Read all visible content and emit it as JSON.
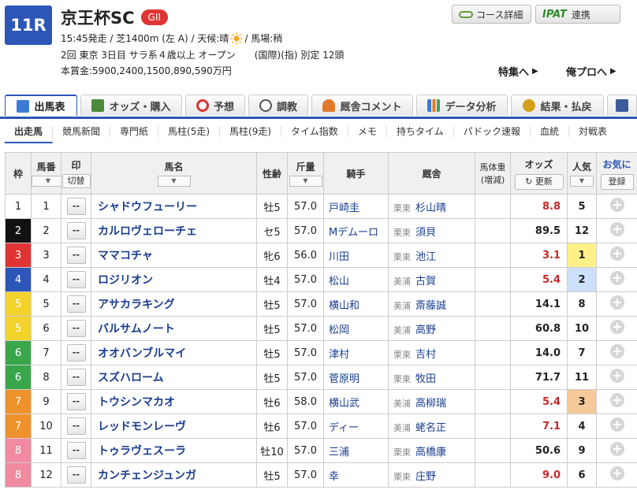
{
  "header": {
    "race_no": "11R",
    "race_name": "京王杯SC",
    "grade": "GII",
    "info_line1_a": "15:45発走 / 芝1400m (左 A) / 天候:晴",
    "info_line1_b": "/ 馬場:稍",
    "info_line2": "2回 東京 3日目 サラ系４歳以上 オープン　　(国際)(指) 別定 12頭",
    "info_line3": "本賞金:5900,2400,1500,890,590万円",
    "course_btn": "コース詳細",
    "ipat_logo": "IPAT",
    "ipat_btn": "連携",
    "link_feature": "特集へ",
    "link_pro": "俺プロへ"
  },
  "tabs": [
    {
      "label": "出馬表",
      "icon": "table-icon",
      "color": "#3a7bd5"
    },
    {
      "label": "オッズ・購入",
      "icon": "odds-icon",
      "color": "#4c8b3a"
    },
    {
      "label": "予想",
      "icon": "target-icon",
      "color": "#d33"
    },
    {
      "label": "調教",
      "icon": "stopwatch-icon",
      "color": "#555"
    },
    {
      "label": "厩舎コメント",
      "icon": "stable-icon",
      "color": "#e07a2a"
    },
    {
      "label": "データ分析",
      "icon": "chart-icon",
      "color": "#3a7bd5"
    },
    {
      "label": "結果・払戻",
      "icon": "coins-icon",
      "color": "#d4a017"
    },
    {
      "label": "",
      "icon": "video-icon",
      "color": "#3b5b9a"
    }
  ],
  "subnav": [
    "出走馬",
    "競馬新聞",
    "専門紙",
    "馬柱(5走)",
    "馬柱(9走)",
    "タイム指数",
    "メモ",
    "持ちタイム",
    "パドック速報",
    "血統",
    "対戦表"
  ],
  "table": {
    "headers": {
      "waku": "枠",
      "umaban": "馬番",
      "mark": "印",
      "mark_btn": "切替",
      "name": "馬名",
      "sexage": "性齢",
      "weight": "斤量",
      "jockey": "騎手",
      "stable": "厩舎",
      "body": "馬体重",
      "body_sub": "(増減)",
      "odds": "オッズ",
      "refresh": "更新",
      "pop": "人気",
      "fav": "お気に",
      "reg": "登録"
    },
    "mark_value": "--",
    "rows": [
      {
        "waku": "1",
        "umaban": "1",
        "name": "シャドウフューリー",
        "sexage": "牡5",
        "weight": "57.0",
        "jockey": "戸崎圭",
        "area": "栗東",
        "trainer": "杉山晴",
        "odds": "8.8",
        "hot": true,
        "pop": "5",
        "popbg": "",
        "wakubg": "#ffffff",
        "wakufg": "#222"
      },
      {
        "waku": "2",
        "umaban": "2",
        "name": "カルロヴェローチェ",
        "sexage": "セ5",
        "weight": "57.0",
        "jockey": "Mデムーロ",
        "area": "栗東",
        "trainer": "須貝",
        "odds": "89.5",
        "hot": false,
        "pop": "12",
        "popbg": "",
        "wakubg": "#111111",
        "wakufg": "#fff"
      },
      {
        "waku": "3",
        "umaban": "3",
        "name": "ママコチャ",
        "sexage": "牝6",
        "weight": "56.0",
        "jockey": "川田",
        "area": "栗東",
        "trainer": "池江",
        "odds": "3.1",
        "hot": true,
        "pop": "1",
        "popbg": "#fff08a",
        "wakubg": "#e03434",
        "wakufg": "#fff"
      },
      {
        "waku": "4",
        "umaban": "4",
        "name": "ロジリオン",
        "sexage": "牡4",
        "weight": "57.0",
        "jockey": "松山",
        "area": "美浦",
        "trainer": "古賀",
        "odds": "5.4",
        "hot": true,
        "pop": "2",
        "popbg": "#cde0fa",
        "wakubg": "#2c56b8",
        "wakufg": "#fff"
      },
      {
        "waku": "5",
        "umaban": "5",
        "name": "アサカラキング",
        "sexage": "牡5",
        "weight": "57.0",
        "jockey": "横山和",
        "area": "美浦",
        "trainer": "斎藤誠",
        "odds": "14.1",
        "hot": false,
        "pop": "8",
        "popbg": "",
        "wakubg": "#f2d32b",
        "wakufg": "#fff"
      },
      {
        "waku": "5",
        "umaban": "6",
        "name": "バルサムノート",
        "sexage": "牡5",
        "weight": "57.0",
        "jockey": "松岡",
        "area": "美浦",
        "trainer": "高野",
        "odds": "60.8",
        "hot": false,
        "pop": "10",
        "popbg": "",
        "wakubg": "#f2d32b",
        "wakufg": "#fff"
      },
      {
        "waku": "6",
        "umaban": "7",
        "name": "オオバンブルマイ",
        "sexage": "牡5",
        "weight": "57.0",
        "jockey": "津村",
        "area": "栗東",
        "trainer": "吉村",
        "odds": "14.0",
        "hot": false,
        "pop": "7",
        "popbg": "",
        "wakubg": "#3aa64a",
        "wakufg": "#fff"
      },
      {
        "waku": "6",
        "umaban": "8",
        "name": "スズハローム",
        "sexage": "牡5",
        "weight": "57.0",
        "jockey": "菅原明",
        "area": "栗東",
        "trainer": "牧田",
        "odds": "71.7",
        "hot": false,
        "pop": "11",
        "popbg": "",
        "wakubg": "#3aa64a",
        "wakufg": "#fff"
      },
      {
        "waku": "7",
        "umaban": "9",
        "name": "トウシンマカオ",
        "sexage": "牡6",
        "weight": "58.0",
        "jockey": "横山武",
        "area": "美浦",
        "trainer": "高柳瑞",
        "odds": "5.4",
        "hot": true,
        "pop": "3",
        "popbg": "#f5c99a",
        "wakubg": "#f0922b",
        "wakufg": "#fff"
      },
      {
        "waku": "7",
        "umaban": "10",
        "name": "レッドモンレーヴ",
        "sexage": "牡6",
        "weight": "57.0",
        "jockey": "ディー",
        "area": "美浦",
        "trainer": "蛯名正",
        "odds": "7.1",
        "hot": true,
        "pop": "4",
        "popbg": "",
        "wakubg": "#f0922b",
        "wakufg": "#fff"
      },
      {
        "waku": "8",
        "umaban": "11",
        "name": "トゥラヴェスーラ",
        "sexage": "牡10",
        "weight": "57.0",
        "jockey": "三浦",
        "area": "栗東",
        "trainer": "高橋康",
        "odds": "50.6",
        "hot": false,
        "pop": "9",
        "popbg": "",
        "wakubg": "#f08aa0",
        "wakufg": "#fff"
      },
      {
        "waku": "8",
        "umaban": "12",
        "name": "カンチェンジュンガ",
        "sexage": "牡5",
        "weight": "57.0",
        "jockey": "幸",
        "area": "栗東",
        "trainer": "庄野",
        "odds": "9.0",
        "hot": true,
        "pop": "6",
        "popbg": "",
        "wakubg": "#f08aa0",
        "wakufg": "#fff"
      }
    ]
  }
}
